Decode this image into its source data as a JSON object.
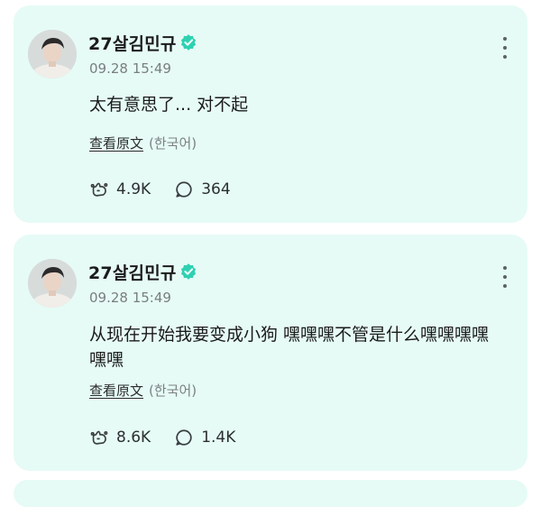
{
  "posts": [
    {
      "username": "27살김민규",
      "timestamp": "09.28 15:49",
      "text": "太有意思了... 对不起",
      "translate_label": "查看原文",
      "original_lang": "(한국어)",
      "likes": "4.9K",
      "comments": "364"
    },
    {
      "username": "27살김민규",
      "timestamp": "09.28 15:49",
      "text": "从现在开始我要变成小狗 嘿嘿嘿不管是什么嘿嘿嘿嘿嘿嘿",
      "translate_label": "查看原文",
      "original_lang": "(한국어)",
      "likes": "8.6K",
      "comments": "1.4K"
    }
  ],
  "icons": {
    "verified": "verified-badge-icon",
    "more": "more-vertical-icon",
    "like": "paw-like-icon",
    "comment": "speech-bubble-icon"
  },
  "colors": {
    "card_bg": "#e6fbf6",
    "verified": "#2ed1b2"
  }
}
